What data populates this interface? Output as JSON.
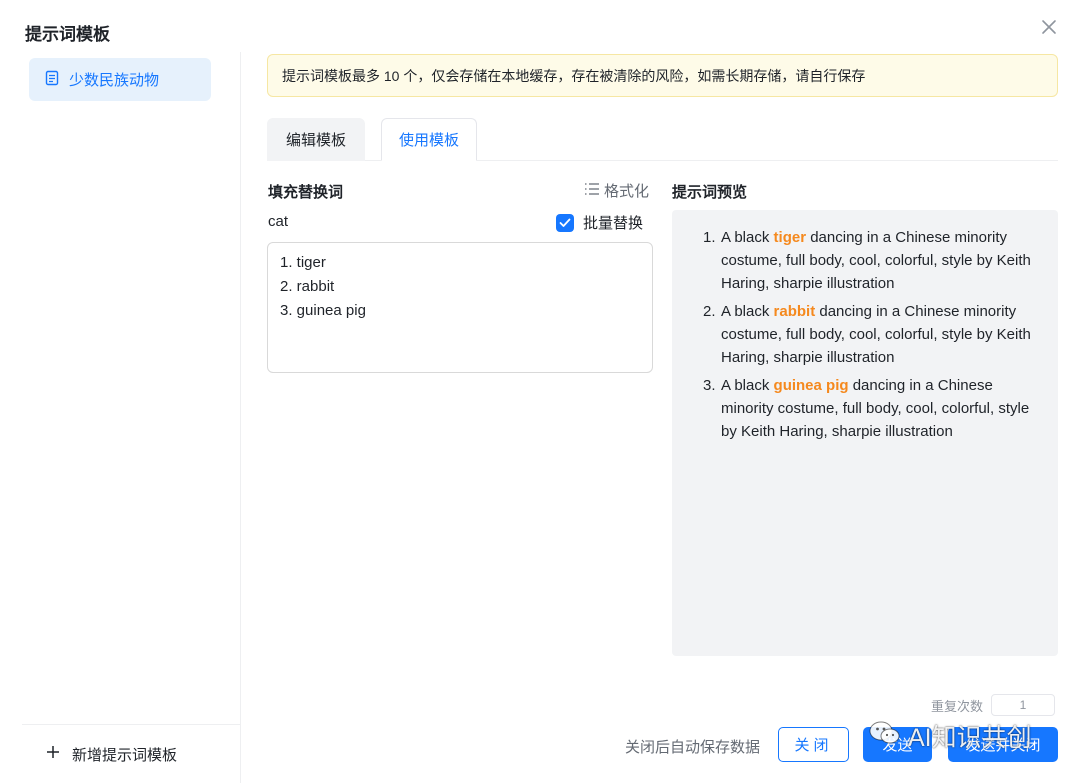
{
  "dialog": {
    "title": "提示词模板"
  },
  "sidebar": {
    "items": [
      {
        "label": "少数民族动物"
      }
    ],
    "add_label": "新增提示词模板"
  },
  "notice": {
    "text": "提示词模板最多 10 个，仅会存储在本地缓存，存在被清除的风险，如需长期存储，请自行保存"
  },
  "tabs": [
    {
      "label": "编辑模板",
      "active": false
    },
    {
      "label": "使用模板",
      "active": true
    }
  ],
  "fill": {
    "label": "填充替换词",
    "format_label": "格式化",
    "target_word": "cat",
    "batch_label": "批量替换",
    "batch_checked": true,
    "lines": [
      "1. tiger",
      "2. rabbit",
      "3. guinea pig"
    ]
  },
  "preview": {
    "label": "提示词预览",
    "items": [
      {
        "num": "1.",
        "prefix": "A black ",
        "highlight": "tiger",
        "suffix": " dancing in a Chinese minority costume, full body, cool, colorful, style by Keith Haring, sharpie illustration"
      },
      {
        "num": "2.",
        "prefix": "A black ",
        "highlight": "rabbit",
        "suffix": " dancing in a Chinese minority costume, full body, cool, colorful, style by Keith Haring, sharpie illustration"
      },
      {
        "num": "3.",
        "prefix": "A black ",
        "highlight": "guinea pig",
        "suffix": " dancing in a Chinese minority costume, full body, cool, colorful, style by Keith Haring, sharpie illustration"
      }
    ]
  },
  "footer": {
    "repeat_label": "重复次数",
    "repeat_value": "1",
    "autosave_text": "关闭后自动保存数据",
    "close_label": "关闭",
    "send_label": "发送",
    "send_close_label": "发送并关闭"
  },
  "watermark": {
    "text": "AI知识共创"
  },
  "colors": {
    "accent": "#1677ff",
    "highlight": "#f5891e",
    "notice_bg": "#fefbe8"
  }
}
